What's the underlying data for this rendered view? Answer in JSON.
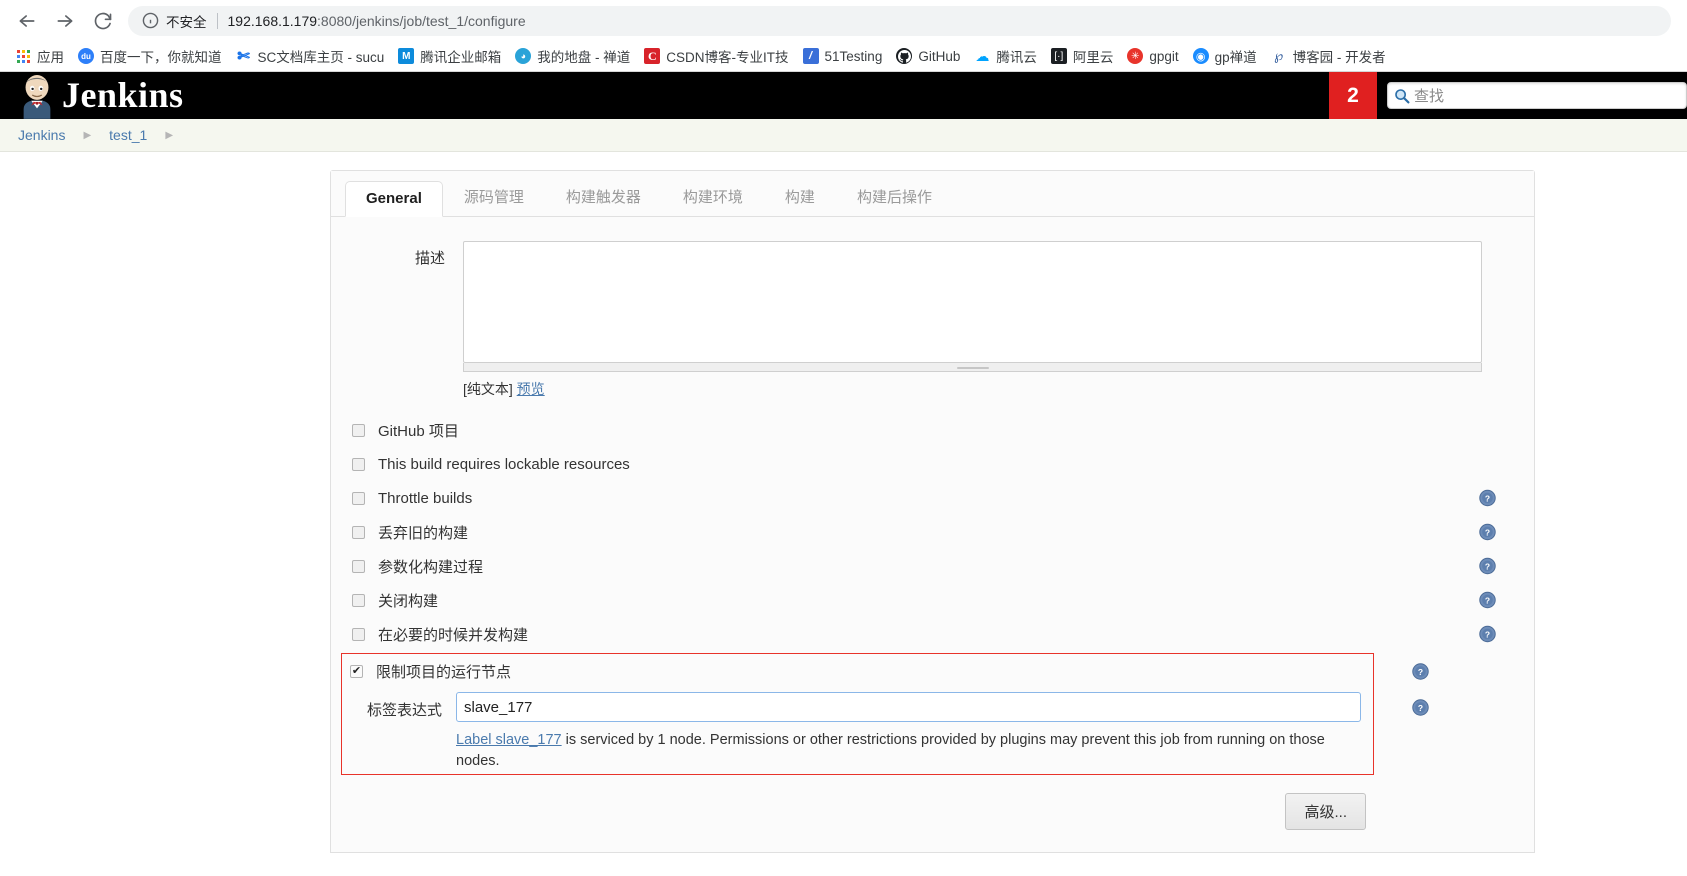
{
  "browser": {
    "back_icon": "back-arrow-icon",
    "forward_icon": "forward-arrow-icon",
    "reload_icon": "reload-icon",
    "security_label": "不安全",
    "url": "192.168.1.179:8080/jenkins/job/test_1/configure",
    "url_host": "192.168.1.179",
    "url_rest": ":8080/jenkins/job/test_1/configure",
    "bookmarks": [
      {
        "label": "应用",
        "icon": "apps-grid-icon",
        "glyph": ""
      },
      {
        "label": "百度一下，你就知道",
        "icon": "baidu-icon",
        "glyph": "度"
      },
      {
        "label": "SC文档库主页 - sucu",
        "icon": "sc-scissors-icon",
        "glyph": "X"
      },
      {
        "label": "腾讯企业邮箱",
        "icon": "tencent-mail-icon",
        "glyph": "M"
      },
      {
        "label": "我的地盘 - 禅道",
        "icon": "zentao-icon",
        "glyph": "●"
      },
      {
        "label": "CSDN博客-专业IT技",
        "icon": "csdn-icon",
        "glyph": "C"
      },
      {
        "label": "51Testing",
        "icon": "testing51-icon",
        "glyph": "/"
      },
      {
        "label": "GitHub",
        "icon": "github-icon",
        "glyph": ""
      },
      {
        "label": "腾讯云",
        "icon": "tencent-cloud-icon",
        "glyph": "◇"
      },
      {
        "label": "阿里云",
        "icon": "aliyun-icon",
        "glyph": "[·]"
      },
      {
        "label": "gpgit",
        "icon": "gpgit-icon",
        "glyph": "✹"
      },
      {
        "label": "gp禅道",
        "icon": "gp-zentao-icon",
        "glyph": "◉"
      },
      {
        "label": "博客园 - 开发者",
        "icon": "cnblogs-icon",
        "glyph": "ߤ"
      }
    ]
  },
  "jenkins": {
    "title": "Jenkins",
    "executor_badge": "2",
    "search_placeholder": "查找",
    "breadcrumbs": [
      {
        "label": "Jenkins"
      },
      {
        "label": "test_1"
      }
    ],
    "breadcrumb_separator": "▶"
  },
  "config": {
    "tabs": [
      {
        "label": "General",
        "active": true
      },
      {
        "label": "源码管理",
        "active": false
      },
      {
        "label": "构建触发器",
        "active": false
      },
      {
        "label": "构建环境",
        "active": false
      },
      {
        "label": "构建",
        "active": false
      },
      {
        "label": "构建后操作",
        "active": false
      }
    ],
    "description": {
      "label": "描述",
      "value": "",
      "markup_note": "[纯文本]",
      "preview_link": "预览"
    },
    "checkboxes": [
      {
        "label": "GitHub 项目",
        "checked": false,
        "help": false
      },
      {
        "label": "This build requires lockable resources",
        "checked": false,
        "help": false
      },
      {
        "label": "Throttle builds",
        "checked": false,
        "help": true
      },
      {
        "label": "丢弃旧的构建",
        "checked": false,
        "help": true
      },
      {
        "label": "参数化构建过程",
        "checked": false,
        "help": true
      },
      {
        "label": "关闭构建",
        "checked": false,
        "help": true
      },
      {
        "label": "在必要的时候并发构建",
        "checked": false,
        "help": true
      }
    ],
    "restrict": {
      "checkbox_label": "限制项目的运行节点",
      "checked": true,
      "label_expression_label": "标签表达式",
      "label_expression_value": "slave_177",
      "help_link_text": "Label slave_177",
      "help_text": " is serviced by 1 node. Permissions or other restrictions provided by plugins may prevent this job from running on those nodes.",
      "highlight_color": "#e8332a"
    },
    "advanced_button": "高级..."
  }
}
